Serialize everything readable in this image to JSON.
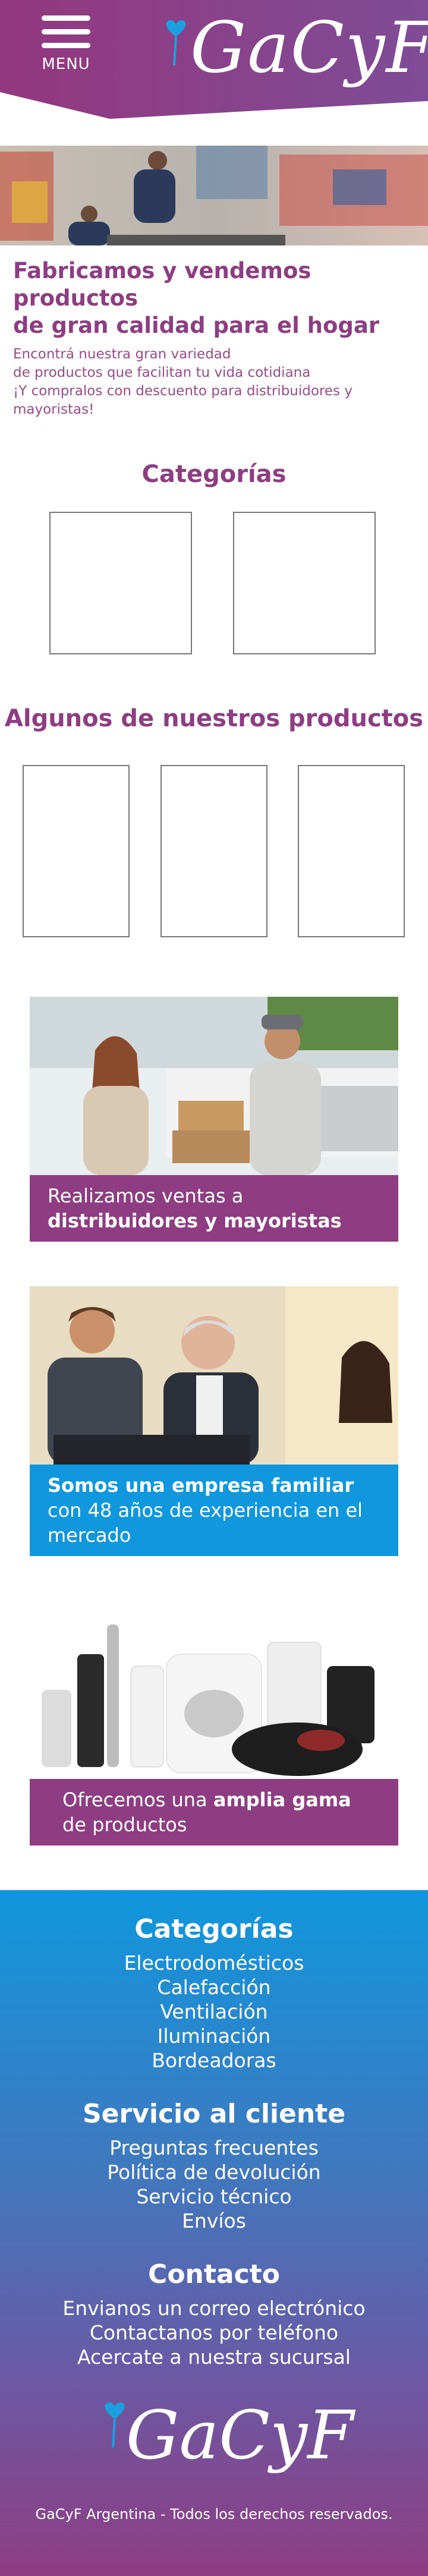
{
  "header": {
    "menu_label": "MENU",
    "logo_text": "GaCyF",
    "colors": {
      "purple": "#8e3d82",
      "blue": "#1097dd",
      "heart": "#1ba0e0"
    }
  },
  "hero": {
    "image": "factory-workers-photo"
  },
  "intro": {
    "title_line1": "Fabricamos y vendemos productos",
    "title_line2": "de gran calidad para el hogar",
    "line1": "Encontrá nuestra gran variedad",
    "line2": "de productos que facilitan tu vida cotidiana",
    "line3": "¡Y compralos con descuento para distribuidores y",
    "line4": "mayoristas!"
  },
  "categories": {
    "title": "Categorías"
  },
  "products": {
    "title": "Algunos de nuestros productos"
  },
  "promos": [
    {
      "text": "Realizamos ventas a ",
      "bold": "distribuidores y mayoristas",
      "color": "#8e3d82",
      "image": "delivery-photo"
    },
    {
      "bold": "Somos una empresa familiar",
      "text": " con 48 años de experiencia en el mercado",
      "color": "#1097dd",
      "image": "business-meeting-photo"
    },
    {
      "text": "Ofrecemos una ",
      "bold": "amplia gama",
      "text2": " de productos",
      "color": "#8e3d82",
      "image": "appliances-photo"
    }
  ],
  "footer": {
    "categories_title": "Categorías",
    "categories": [
      "Electrodomésticos",
      "Calefacción",
      "Ventilación",
      "Iluminación",
      "Bordeadoras"
    ],
    "service_title": "Servicio al cliente",
    "service": [
      "Preguntas frecuentes",
      "Política de devolución",
      "Servicio técnico",
      "Envíos"
    ],
    "contact_title": "Contacto",
    "contact": [
      "Envianos un correo electrónico",
      "Contactanos por teléfono",
      "Acercate a nuestra sucursal"
    ],
    "logo_text": "GaCyF",
    "copyright": "GaCyF Argentina - Todos los derechos reservados."
  }
}
